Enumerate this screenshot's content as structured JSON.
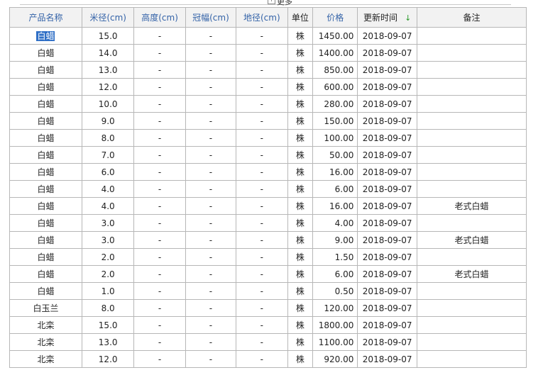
{
  "top": {
    "more_label": "更多"
  },
  "columns": [
    {
      "label": "产品名称",
      "style": "blue"
    },
    {
      "label": "米径(cm)",
      "style": "blue"
    },
    {
      "label": "高度(cm)",
      "style": "blue"
    },
    {
      "label": "冠幅(cm)",
      "style": "blue"
    },
    {
      "label": "地径(cm)",
      "style": "blue"
    },
    {
      "label": "单位",
      "style": "dark"
    },
    {
      "label": "价格",
      "style": "blue"
    },
    {
      "label": "更新时间",
      "style": "dark"
    },
    {
      "label": "备注",
      "style": "dark"
    }
  ],
  "sort_icon": "arrow-down-icon",
  "rows": [
    [
      "白蜡",
      "15.0",
      "-",
      "-",
      "-",
      "株",
      "1450.00",
      "2018-09-07",
      ""
    ],
    [
      "白蜡",
      "14.0",
      "-",
      "-",
      "-",
      "株",
      "1400.00",
      "2018-09-07",
      ""
    ],
    [
      "白蜡",
      "13.0",
      "-",
      "-",
      "-",
      "株",
      "850.00",
      "2018-09-07",
      ""
    ],
    [
      "白蜡",
      "12.0",
      "-",
      "-",
      "-",
      "株",
      "600.00",
      "2018-09-07",
      ""
    ],
    [
      "白蜡",
      "10.0",
      "-",
      "-",
      "-",
      "株",
      "280.00",
      "2018-09-07",
      ""
    ],
    [
      "白蜡",
      "9.0",
      "-",
      "-",
      "-",
      "株",
      "150.00",
      "2018-09-07",
      ""
    ],
    [
      "白蜡",
      "8.0",
      "-",
      "-",
      "-",
      "株",
      "100.00",
      "2018-09-07",
      ""
    ],
    [
      "白蜡",
      "7.0",
      "-",
      "-",
      "-",
      "株",
      "50.00",
      "2018-09-07",
      ""
    ],
    [
      "白蜡",
      "6.0",
      "-",
      "-",
      "-",
      "株",
      "16.00",
      "2018-09-07",
      ""
    ],
    [
      "白蜡",
      "4.0",
      "-",
      "-",
      "-",
      "株",
      "6.00",
      "2018-09-07",
      ""
    ],
    [
      "白蜡",
      "4.0",
      "-",
      "-",
      "-",
      "株",
      "16.00",
      "2018-09-07",
      "老式白蜡"
    ],
    [
      "白蜡",
      "3.0",
      "-",
      "-",
      "-",
      "株",
      "4.00",
      "2018-09-07",
      ""
    ],
    [
      "白蜡",
      "3.0",
      "-",
      "-",
      "-",
      "株",
      "9.00",
      "2018-09-07",
      "老式白蜡"
    ],
    [
      "白蜡",
      "2.0",
      "-",
      "-",
      "-",
      "株",
      "1.50",
      "2018-09-07",
      ""
    ],
    [
      "白蜡",
      "2.0",
      "-",
      "-",
      "-",
      "株",
      "6.00",
      "2018-09-07",
      "老式白蜡"
    ],
    [
      "白蜡",
      "1.0",
      "-",
      "-",
      "-",
      "株",
      "0.50",
      "2018-09-07",
      ""
    ],
    [
      "白玉兰",
      "8.0",
      "-",
      "-",
      "-",
      "株",
      "120.00",
      "2018-09-07",
      ""
    ],
    [
      "北栾",
      "15.0",
      "-",
      "-",
      "-",
      "株",
      "1800.00",
      "2018-09-07",
      ""
    ],
    [
      "北栾",
      "13.0",
      "-",
      "-",
      "-",
      "株",
      "1100.00",
      "2018-09-07",
      ""
    ],
    [
      "北栾",
      "12.0",
      "-",
      "-",
      "-",
      "株",
      "920.00",
      "2018-09-07",
      ""
    ]
  ],
  "colors": {
    "header_text": "#3463a8",
    "header_bg": "#f2f2f2",
    "selection": "#2f6fc6",
    "sort_arrow": "#2a9a2a",
    "border": "#b7b7b7"
  }
}
